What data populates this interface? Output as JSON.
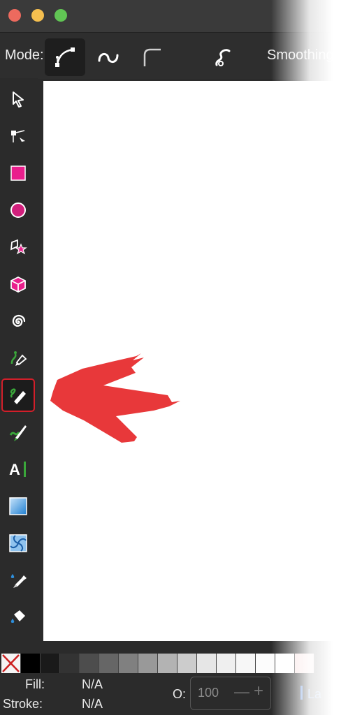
{
  "toolbar": {
    "mode_label": "Mode:",
    "smoothing_label": "Smoothing:",
    "modes": [
      "bezier-mode-icon",
      "spiro-mode-icon",
      "bspline-mode-icon",
      "shape-icon"
    ]
  },
  "toolbox": {
    "tools": [
      "selector-tool",
      "node-tool",
      "rectangle-tool",
      "ellipse-tool",
      "star-tool",
      "3d-box-tool",
      "spiral-tool",
      "bezier-pen-tool",
      "pencil-tool",
      "calligraphy-tool",
      "text-tool",
      "gradient-tool",
      "mesh-tool",
      "dropper-tool",
      "paint-bucket-tool"
    ],
    "selected": "pencil-tool"
  },
  "colors": {
    "accent_pink": "#e91e8c",
    "selection_red": "#d21f2a",
    "annotation_arrow": "#e8383a"
  },
  "status": {
    "fill_label": "Fill:",
    "fill_value": "N/A",
    "stroke_label": "Stroke:",
    "stroke_value": "N/A",
    "opacity_label": "O:",
    "opacity_value": "100",
    "trailing_text": "La"
  }
}
